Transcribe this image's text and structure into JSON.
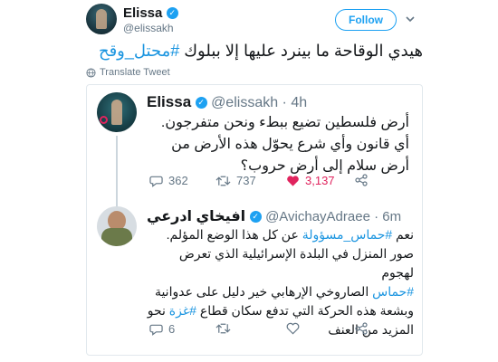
{
  "header": {
    "name": "Elissa",
    "handle": "@elissakh",
    "follow_label": "Follow"
  },
  "tweet": {
    "text_plain": "هيدي الوقاحة ما بينرد عليها إلا ببلوك ",
    "hashtag": "#محتل_وقح",
    "translate_label": "Translate Tweet"
  },
  "quoted_tweet_1": {
    "name": "Elissa",
    "handle": "@elissakh · 4h",
    "text": "أرض فلسطين تضيع ببطء ونحن متفرجون. أي قانون وأي شرع يحوّل هذه الأرض من أرض سلام إلى أرض حروب؟",
    "replies": "362",
    "retweets": "737",
    "likes": "3,137"
  },
  "quoted_tweet_2": {
    "name": "افيخاي ادرعي",
    "handle": "@AvichayAdraee · 6m",
    "line1_a": "نعم ",
    "line1_hash": "#حماس_مسؤولة",
    "line1_b": " عن كل هذا الوضع المؤلم.",
    "line2": "صور المنزل في البلدة الإسرائيلية الذي تعرض لهجوم",
    "line3_hash": "#حماس",
    "line3_b": " الصاروخي الإرهابي خير دليل على عدوانية",
    "line4_a": "وبشعة هذه الحركة التي تدفع سكان قطاع ",
    "line4_hash": "#غزة",
    "line4_b": " نحو",
    "line5": "المزيد من العنف",
    "replies": "6",
    "retweets": "",
    "likes": ""
  },
  "colors": {
    "accent": "#1da1f2",
    "hashtag": "#1b95e0",
    "like": "#e0245e",
    "muted": "#657786"
  }
}
